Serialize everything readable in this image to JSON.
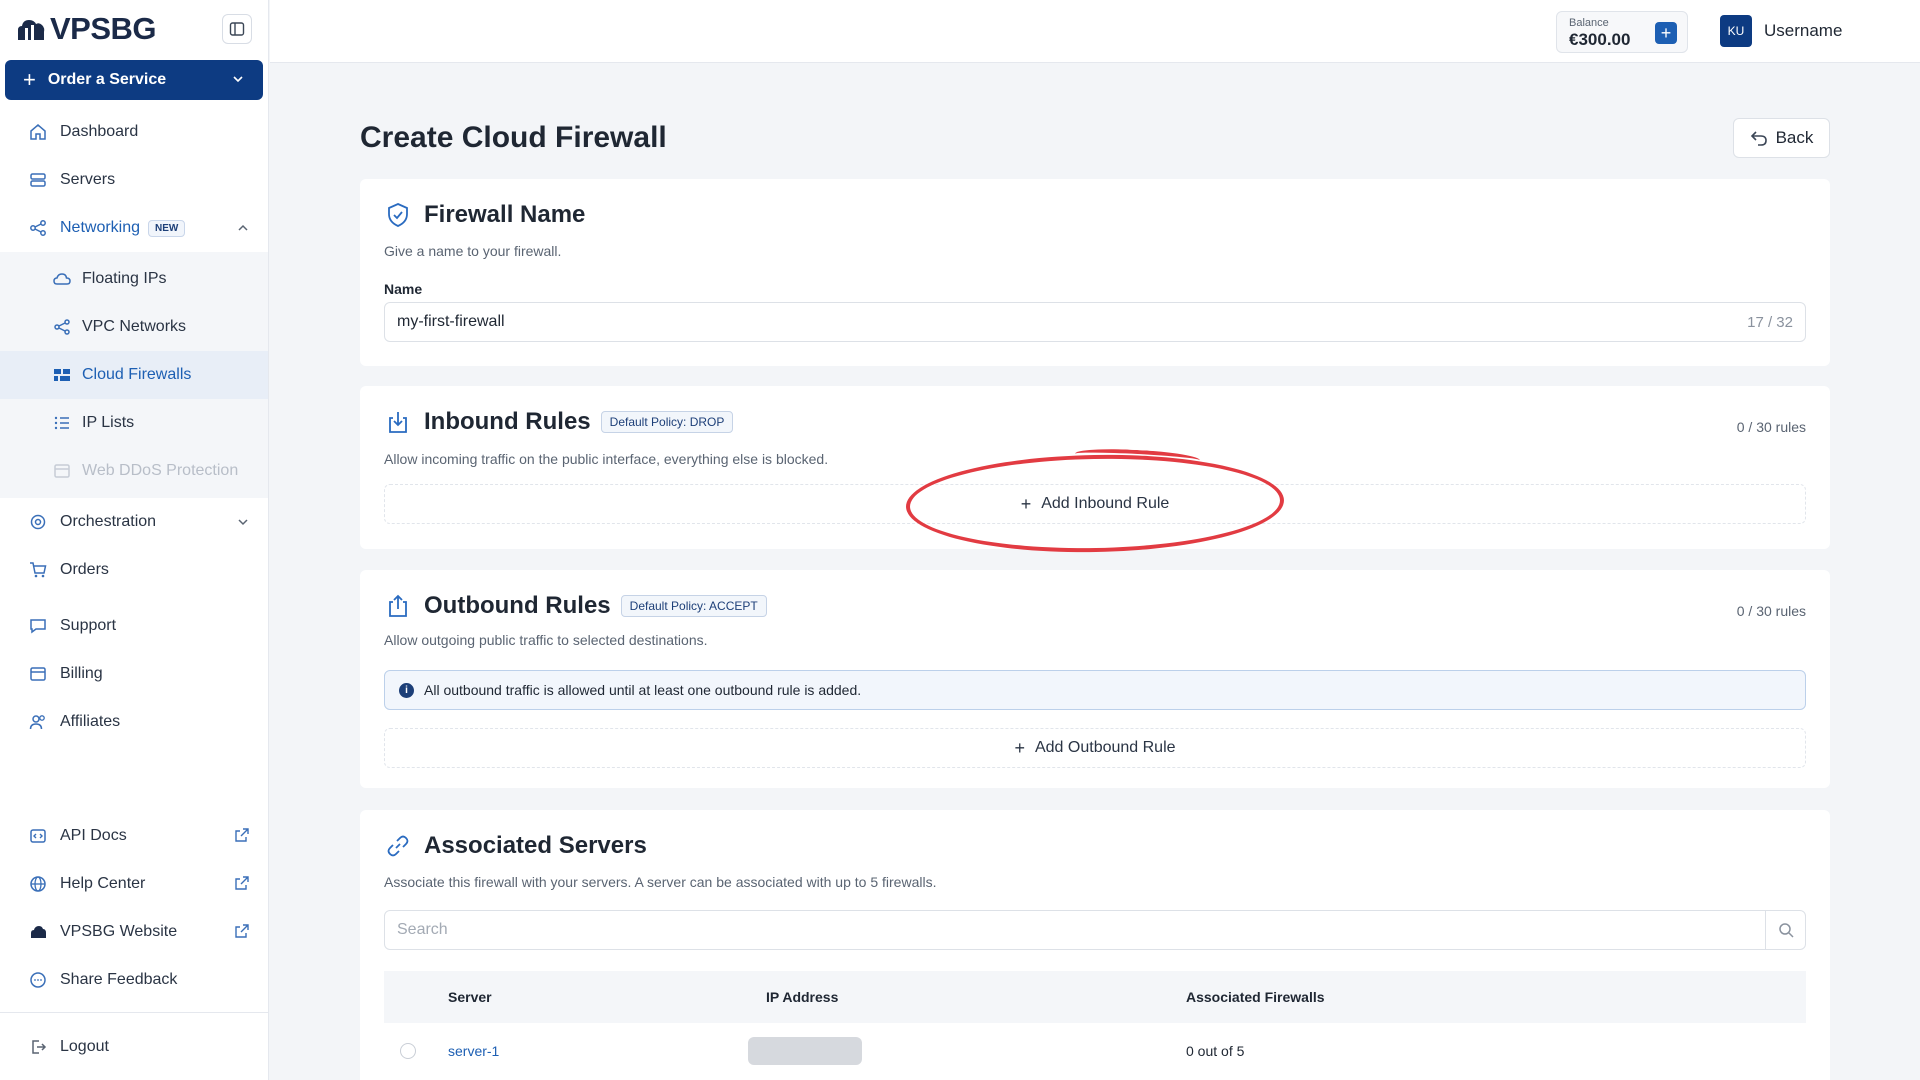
{
  "brand": {
    "name": "VPSBG"
  },
  "sidebar": {
    "order_button": "Order a Service",
    "items": {
      "dashboard": "Dashboard",
      "servers": "Servers",
      "networking": "Networking",
      "networking_badge": "NEW",
      "floating_ips": "Floating IPs",
      "vpc_networks": "VPC Networks",
      "cloud_firewalls": "Cloud Firewalls",
      "ip_lists": "IP Lists",
      "web_ddos": "Web DDoS Protection",
      "orchestration": "Orchestration",
      "orders": "Orders",
      "support": "Support",
      "billing": "Billing",
      "affiliates": "Affiliates",
      "api_docs": "API Docs",
      "help_center": "Help Center",
      "vpsbg_website": "VPSBG Website",
      "share_feedback": "Share Feedback",
      "logout": "Logout"
    }
  },
  "topbar": {
    "balance_label": "Balance",
    "balance_value": "€300.00",
    "avatar_initials": "KU",
    "username": "Username"
  },
  "page": {
    "title": "Create Cloud Firewall",
    "back_label": "Back"
  },
  "firewall_name": {
    "title": "Firewall Name",
    "description": "Give a name to your firewall.",
    "field_label": "Name",
    "value": "my-first-firewall",
    "counter": "17 / 32"
  },
  "inbound": {
    "title": "Inbound Rules",
    "policy": "Default Policy: DROP",
    "description": "Allow incoming traffic on the public interface, everything else is blocked.",
    "count": "0 / 30 rules",
    "add_label": "Add Inbound Rule"
  },
  "outbound": {
    "title": "Outbound Rules",
    "policy": "Default Policy: ACCEPT",
    "description": "Allow outgoing public traffic to selected destinations.",
    "count": "0 / 30 rules",
    "info": "All outbound traffic is allowed until at least one outbound rule is added.",
    "add_label": "Add Outbound Rule"
  },
  "associated": {
    "title": "Associated Servers",
    "description": "Associate this firewall with your servers. A server can be associated with up to 5 firewalls.",
    "search_placeholder": "Search",
    "columns": {
      "server": "Server",
      "ip": "IP Address",
      "firewalls": "Associated Firewalls"
    },
    "rows": [
      {
        "server": "server-1",
        "firewalls": "0 out of 5"
      }
    ]
  },
  "colors": {
    "primary": "#0d3b82",
    "link": "#1d5fb3",
    "annotation": "#e23b42"
  }
}
